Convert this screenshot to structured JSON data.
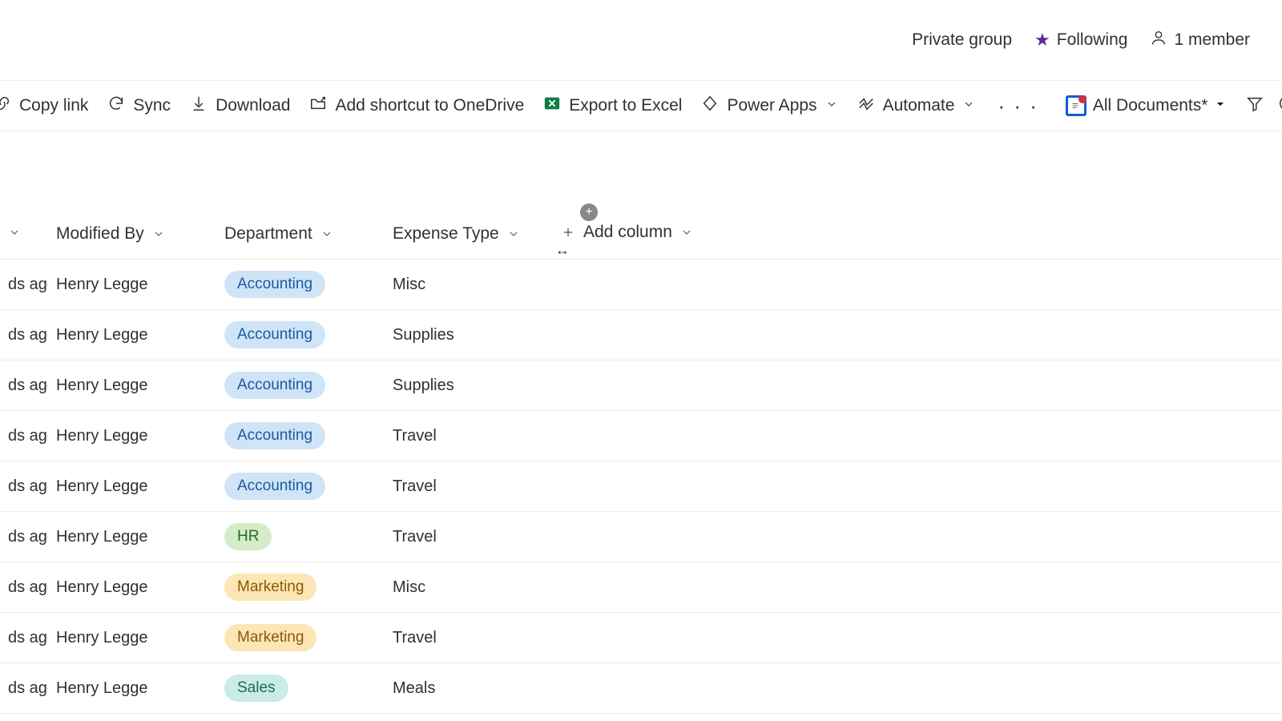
{
  "header": {
    "privacy": "Private group",
    "following": "Following",
    "members": "1 member"
  },
  "commands": {
    "copy_link": "Copy link",
    "sync": "Sync",
    "download": "Download",
    "add_shortcut": "Add shortcut to OneDrive",
    "export_excel": "Export to Excel",
    "power_apps": "Power Apps",
    "automate": "Automate",
    "view_label": "All Documents*"
  },
  "columns": {
    "modified_by": "Modified By",
    "department": "Department",
    "expense_type": "Expense Type",
    "add_column": "Add column"
  },
  "modified_fragment": "ds ago",
  "rows": [
    {
      "modified_by": "Henry Legge",
      "department": "Accounting",
      "dept_class": "accounting",
      "expense_type": "Misc"
    },
    {
      "modified_by": "Henry Legge",
      "department": "Accounting",
      "dept_class": "accounting",
      "expense_type": "Supplies"
    },
    {
      "modified_by": "Henry Legge",
      "department": "Accounting",
      "dept_class": "accounting",
      "expense_type": "Supplies"
    },
    {
      "modified_by": "Henry Legge",
      "department": "Accounting",
      "dept_class": "accounting",
      "expense_type": "Travel"
    },
    {
      "modified_by": "Henry Legge",
      "department": "Accounting",
      "dept_class": "accounting",
      "expense_type": "Travel"
    },
    {
      "modified_by": "Henry Legge",
      "department": "HR",
      "dept_class": "hr",
      "expense_type": "Travel"
    },
    {
      "modified_by": "Henry Legge",
      "department": "Marketing",
      "dept_class": "marketing",
      "expense_type": "Misc"
    },
    {
      "modified_by": "Henry Legge",
      "department": "Marketing",
      "dept_class": "marketing",
      "expense_type": "Travel"
    },
    {
      "modified_by": "Henry Legge",
      "department": "Sales",
      "dept_class": "sales",
      "expense_type": "Meals"
    }
  ]
}
